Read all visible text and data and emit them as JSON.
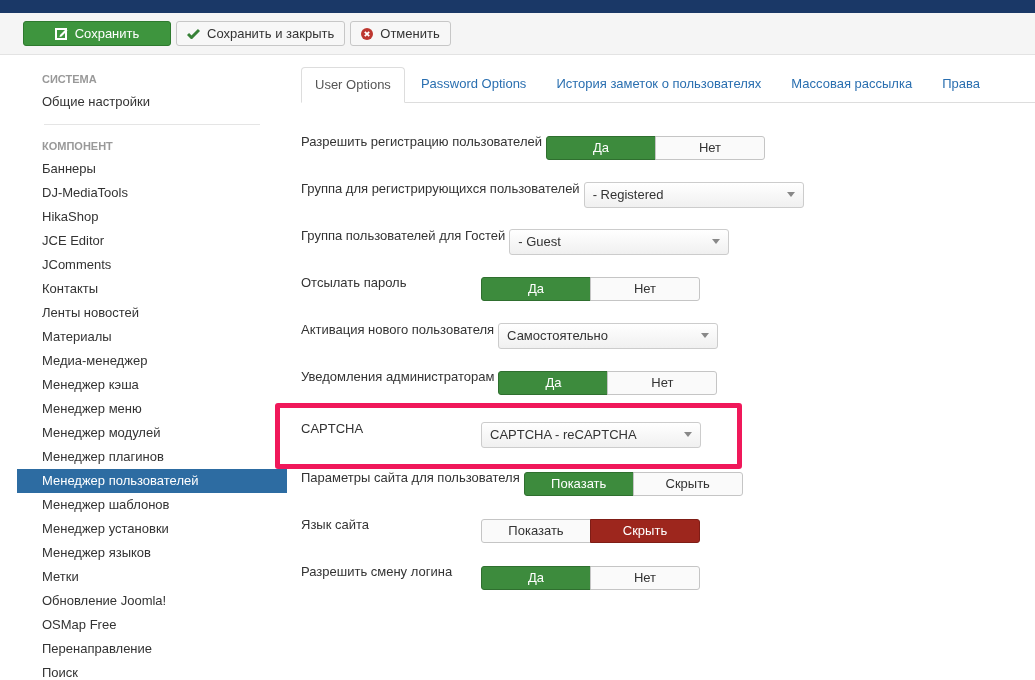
{
  "toolbar": [
    {
      "label": "Сохранить",
      "kind": "save"
    },
    {
      "label": "Сохранить и закрыть",
      "kind": "check"
    },
    {
      "label": "Отменить",
      "kind": "cancel"
    }
  ],
  "sidebar": [
    {
      "heading": "СИСТЕМА",
      "items": [
        {
          "label": "Общие настройки",
          "selected": false
        }
      ]
    },
    {
      "heading": "КОМПОНЕНТ",
      "items": [
        {
          "label": "Баннеры",
          "selected": false
        },
        {
          "label": "DJ-MediaTools",
          "selected": false
        },
        {
          "label": "HikaShop",
          "selected": false
        },
        {
          "label": "JCE Editor",
          "selected": false
        },
        {
          "label": "JComments",
          "selected": false
        },
        {
          "label": "Контакты",
          "selected": false
        },
        {
          "label": "Ленты новостей",
          "selected": false
        },
        {
          "label": "Материалы",
          "selected": false
        },
        {
          "label": "Медиа-менеджер",
          "selected": false
        },
        {
          "label": "Менеджер кэша",
          "selected": false
        },
        {
          "label": "Менеджер меню",
          "selected": false
        },
        {
          "label": "Менеджер модулей",
          "selected": false
        },
        {
          "label": "Менеджер плагинов",
          "selected": false
        },
        {
          "label": "Менеджер пользователей",
          "selected": true
        },
        {
          "label": "Менеджер шаблонов",
          "selected": false
        },
        {
          "label": "Менеджер установки",
          "selected": false
        },
        {
          "label": "Менеджер языков",
          "selected": false
        },
        {
          "label": "Метки",
          "selected": false
        },
        {
          "label": "Обновление Joomla!",
          "selected": false
        },
        {
          "label": "OSMap Free",
          "selected": false
        },
        {
          "label": "Перенаправление",
          "selected": false
        },
        {
          "label": "Поиск",
          "selected": false
        }
      ]
    }
  ],
  "tabs": [
    {
      "label": "User Options",
      "selected": true
    },
    {
      "label": "Password Options",
      "selected": false
    },
    {
      "label": "История заметок о пользователях",
      "selected": false
    },
    {
      "label": "Массовая рассылка",
      "selected": false
    },
    {
      "label": "Права",
      "selected": false
    }
  ],
  "fields": [
    {
      "label": "Разрешить регистрацию пользователей",
      "kind": "toggle",
      "highlighted": false,
      "options": [
        {
          "label": "Да",
          "selected": true
        },
        {
          "label": "Нет",
          "selected": false
        }
      ]
    },
    {
      "label": "Группа для регистрирующихся пользователей",
      "kind": "select",
      "highlighted": false,
      "value": "- Registered"
    },
    {
      "label": "Группа пользователей для Гостей",
      "kind": "select",
      "highlighted": false,
      "value": "- Guest"
    },
    {
      "label": "Отсылать пароль",
      "kind": "toggle",
      "highlighted": false,
      "options": [
        {
          "label": "Да",
          "selected": true
        },
        {
          "label": "Нет",
          "selected": false
        }
      ]
    },
    {
      "label": "Активация нового пользователя",
      "kind": "select",
      "highlighted": false,
      "value": "Самостоятельно"
    },
    {
      "label": "Уведомления администраторам",
      "kind": "toggle",
      "highlighted": false,
      "options": [
        {
          "label": "Да",
          "selected": true
        },
        {
          "label": "Нет",
          "selected": false
        }
      ]
    },
    {
      "label": "CAPTCHA",
      "kind": "select",
      "highlighted": true,
      "value": "CAPTCHA - reCAPTCHA"
    },
    {
      "label": "Параметры сайта для пользователя",
      "kind": "toggle",
      "highlighted": false,
      "options": [
        {
          "label": "Показать",
          "selected": true
        },
        {
          "label": "Скрыть",
          "selected": false
        }
      ]
    },
    {
      "label": "Язык сайта",
      "kind": "toggle",
      "highlighted": false,
      "options": [
        {
          "label": "Показать",
          "selected": false
        },
        {
          "label": "Скрыть",
          "selected": true
        }
      ]
    },
    {
      "label": "Разрешить смену логина",
      "kind": "toggle",
      "highlighted": false,
      "options": [
        {
          "label": "Да",
          "selected": true
        },
        {
          "label": "Нет",
          "selected": false
        }
      ]
    }
  ]
}
